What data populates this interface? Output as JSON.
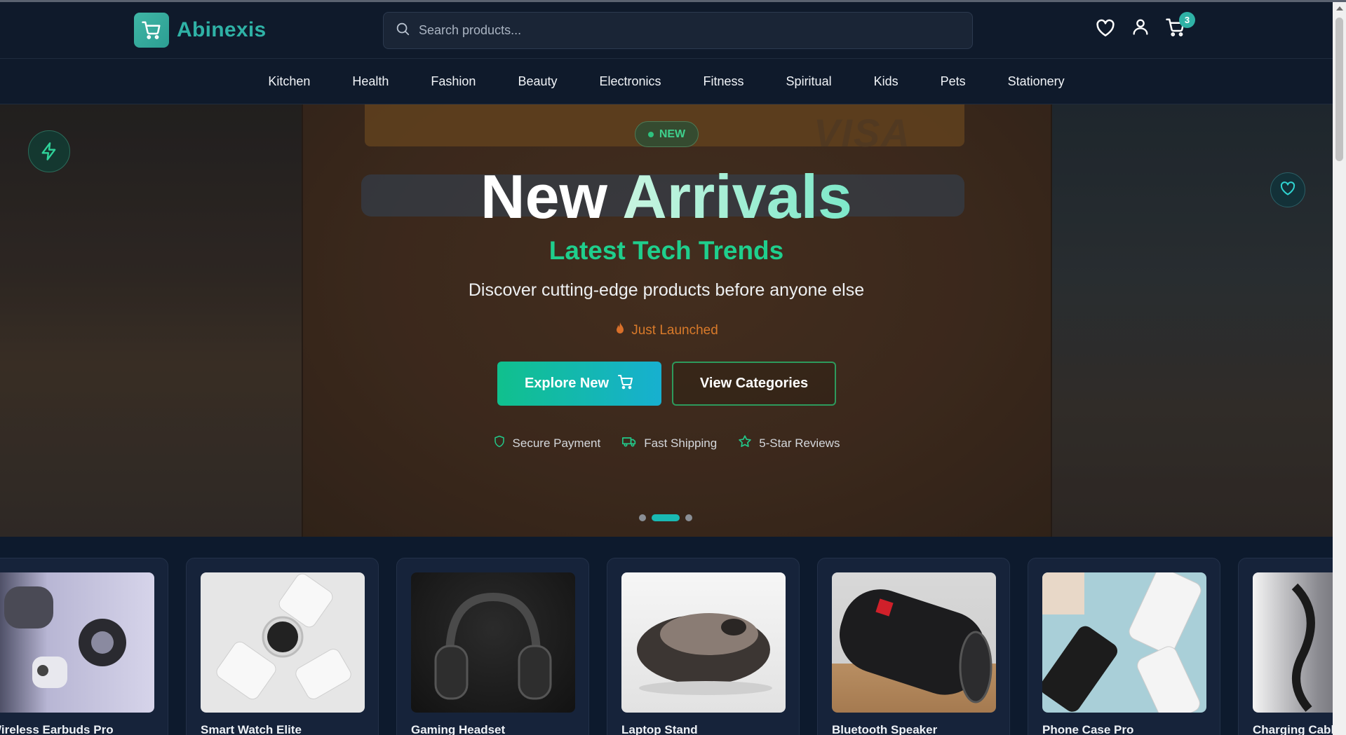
{
  "brand": {
    "name": "Abinexis",
    "accent": "#2fb2a6"
  },
  "search": {
    "placeholder": "Search products..."
  },
  "header": {
    "cart_count": "3",
    "icons": [
      "heart-icon",
      "user-icon",
      "cart-icon"
    ]
  },
  "categories": [
    "Kitchen",
    "Health",
    "Fashion",
    "Beauty",
    "Electronics",
    "Fitness",
    "Spiritual",
    "Kids",
    "Pets",
    "Stationery"
  ],
  "hero": {
    "badge": "NEW",
    "title_part1": "New",
    "title_part2": "Arrivals",
    "subtitle": "Latest Tech Trends",
    "description": "Discover cutting-edge products before anyone else",
    "tagline": "Just Launched",
    "primary_button": "Explore New",
    "secondary_button": "View Categories",
    "trust": [
      "Secure Payment",
      "Fast Shipping",
      "5-Star Reviews"
    ],
    "slides_total": 3,
    "slide_active": 2,
    "background_text": "VISA"
  },
  "products": [
    {
      "name": "Wireless Earbuds Pro"
    },
    {
      "name": "Smart Watch Elite"
    },
    {
      "name": "Gaming Headset"
    },
    {
      "name": "Laptop Stand"
    },
    {
      "name": "Bluetooth Speaker"
    },
    {
      "name": "Phone Case Pro"
    },
    {
      "name": "Charging Cable"
    }
  ]
}
